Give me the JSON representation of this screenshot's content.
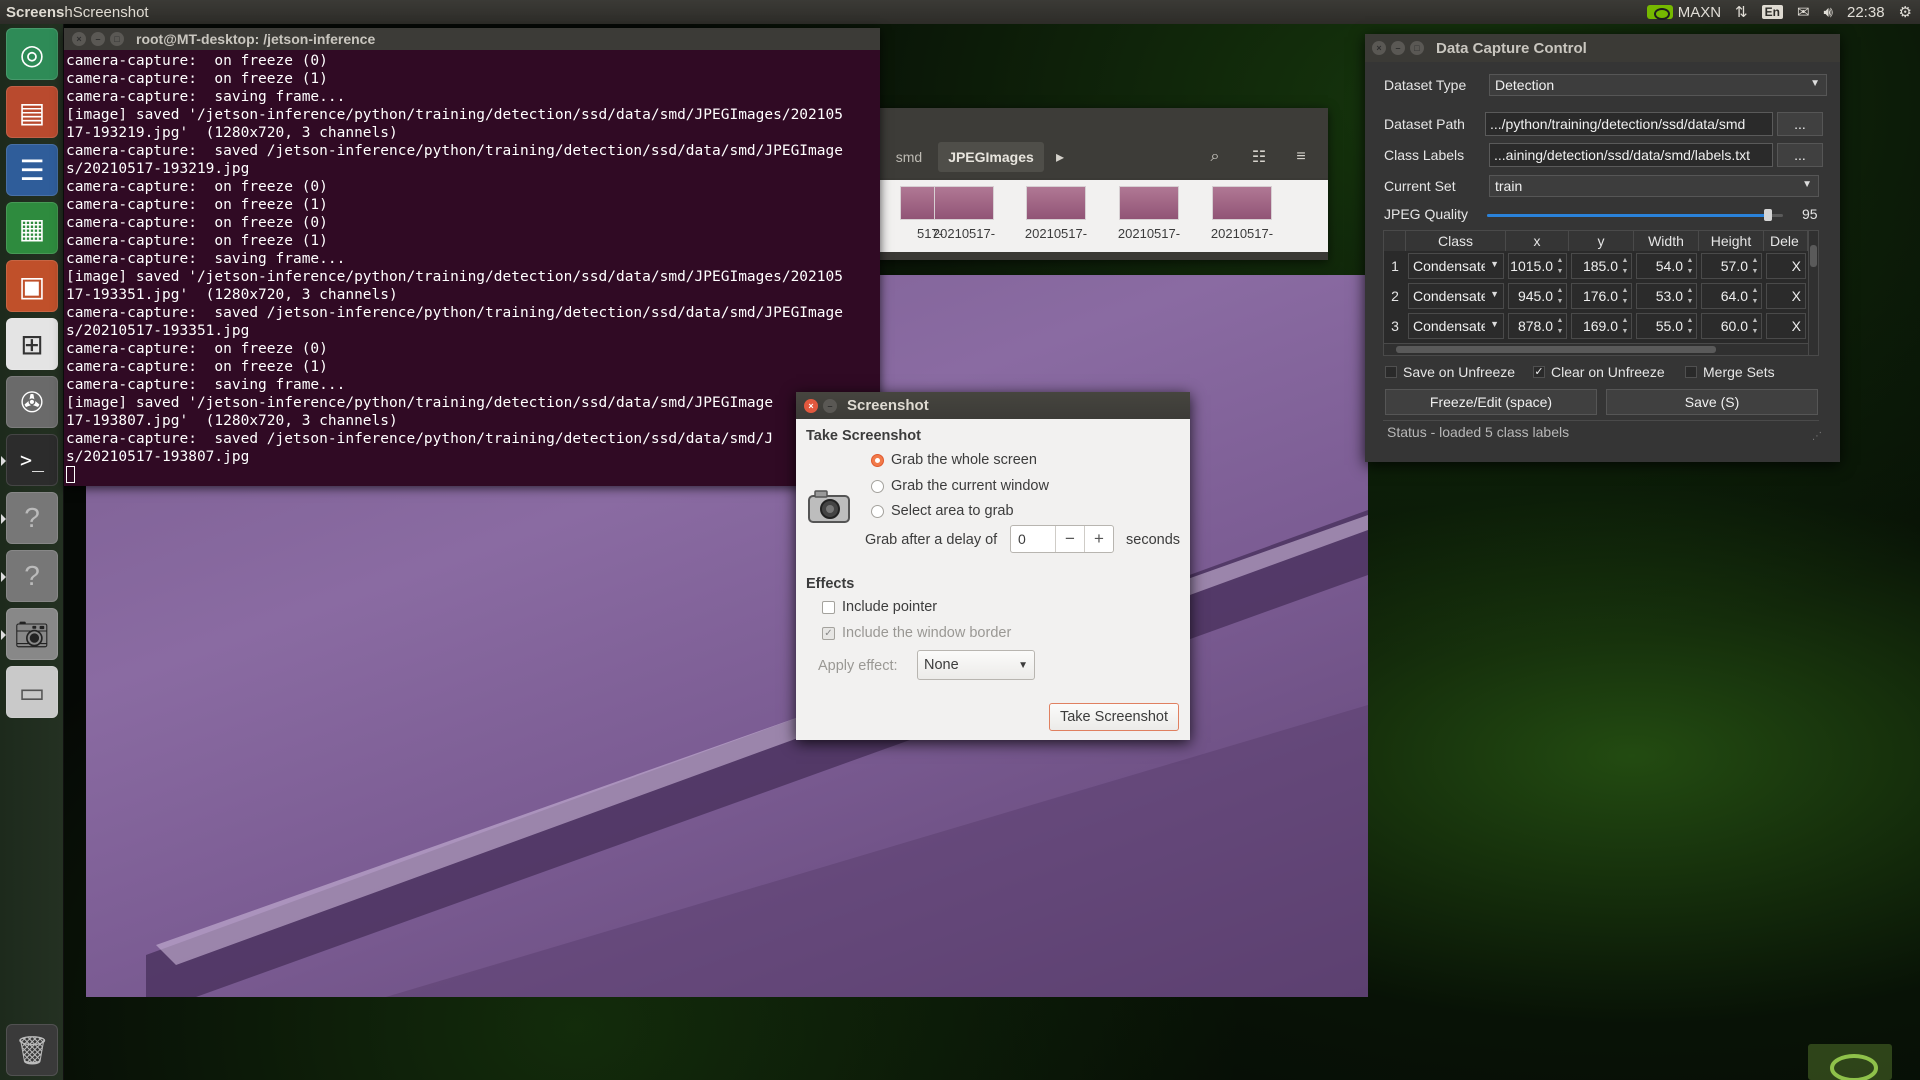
{
  "top_panel": {
    "app_title_bold": "Screens",
    "app_title_rest": "hScreenshot",
    "power_mode": "MAXN",
    "keyboard": "En",
    "clock": "22:38"
  },
  "launcher": {
    "items": [
      "ubuntu-software",
      "files",
      "text-editor",
      "spreadsheet",
      "presentation",
      "store",
      "settings",
      "terminal",
      "unknown-app",
      "unknown-app",
      "screenshot",
      "drive"
    ]
  },
  "terminal": {
    "title": "root@MT-desktop: /jetson-inference",
    "lines": [
      "camera-capture:  on freeze (0)",
      "camera-capture:  on freeze (1)",
      "camera-capture:  saving frame...",
      "[image] saved '/jetson-inference/python/training/detection/ssd/data/smd/JPEGImages/202105",
      "17-193219.jpg'  (1280x720, 3 channels)",
      "camera-capture:  saved /jetson-inference/python/training/detection/ssd/data/smd/JPEGImage",
      "s/20210517-193219.jpg",
      "camera-capture:  on freeze (0)",
      "camera-capture:  on freeze (1)",
      "camera-capture:  on freeze (0)",
      "camera-capture:  on freeze (1)",
      "camera-capture:  saving frame...",
      "[image] saved '/jetson-inference/python/training/detection/ssd/data/smd/JPEGImages/202105",
      "17-193351.jpg'  (1280x720, 3 channels)",
      "camera-capture:  saved /jetson-inference/python/training/detection/ssd/data/smd/JPEGImage",
      "s/20210517-193351.jpg",
      "camera-capture:  on freeze (0)",
      "camera-capture:  on freeze (1)",
      "camera-capture:  saving frame...",
      "[image] saved '/jetson-inference/python/training/detection/ssd/data/smd/JPEGImage",
      "17-193807.jpg'  (1280x720, 3 channels)",
      "camera-capture:  saved /jetson-inference/python/training/detection/ssd/data/smd/J",
      "s/20210517-193807.jpg"
    ]
  },
  "files": {
    "breadcrumbs": [
      "smd",
      "JPEGImages"
    ],
    "thumbnail_label": "20210517-",
    "thumbnail_label_partial": "517-"
  },
  "screenshot_dialog": {
    "title": "Screenshot",
    "take_screenshot_heading": "Take Screenshot",
    "options": [
      "Grab the whole screen",
      "Grab the current window",
      "Select area to grab"
    ],
    "selected_option": 0,
    "delay_label": "Grab after a delay of",
    "delay_value": "0",
    "delay_unit": "seconds",
    "effects_heading": "Effects",
    "include_pointer": "Include pointer",
    "include_border": "Include the window border",
    "apply_effect_label": "Apply effect:",
    "apply_effect_value": "None",
    "take_button": "Take Screenshot",
    "minus": "−",
    "plus": "+"
  },
  "data_capture": {
    "title": "Data Capture Control",
    "dataset_type_label": "Dataset Type",
    "dataset_type": "Detection",
    "dataset_path_label": "Dataset Path",
    "dataset_path": ".../python/training/detection/ssd/data/smd",
    "class_labels_label": "Class Labels",
    "class_labels": "...aining/detection/ssd/data/smd/labels.txt",
    "browse": "...",
    "current_set_label": "Current Set",
    "current_set": "train",
    "jpeg_quality_label": "JPEG Quality",
    "jpeg_quality": "95",
    "jpeg_quality_fraction": 0.95,
    "columns": [
      "Class",
      "x",
      "y",
      "Width",
      "Height",
      "Dele"
    ],
    "rows": [
      {
        "num": "1",
        "class": "Condensate",
        "x": "1015.0",
        "y": "185.0",
        "w": "54.0",
        "h": "57.0",
        "del": "X"
      },
      {
        "num": "2",
        "class": "Condensate",
        "x": "945.0",
        "y": "176.0",
        "w": "53.0",
        "h": "64.0",
        "del": "X"
      },
      {
        "num": "3",
        "class": "Condensate",
        "x": "878.0",
        "y": "169.0",
        "w": "55.0",
        "h": "60.0",
        "del": "X"
      }
    ],
    "save_on_unfreeze": "Save on Unfreeze",
    "clear_on_unfreeze": "Clear on Unfreeze",
    "merge_sets": "Merge Sets",
    "freeze_button": "Freeze/Edit (space)",
    "save_button": "Save (S)",
    "status": "Status - loaded 5 class labels"
  }
}
